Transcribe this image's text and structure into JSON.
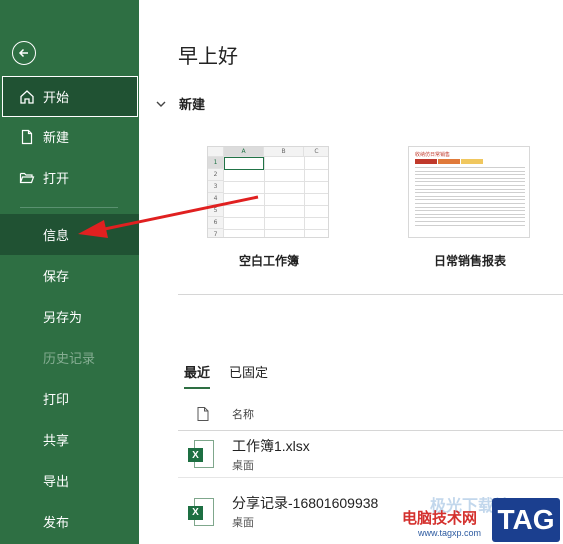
{
  "sidebar": {
    "back_icon": "back-arrow-icon",
    "items": [
      {
        "label": "开始",
        "icon": "home-icon"
      },
      {
        "label": "新建",
        "icon": "new-doc-icon"
      },
      {
        "label": "打开",
        "icon": "folder-open-icon"
      },
      {
        "label": "信息"
      },
      {
        "label": "保存"
      },
      {
        "label": "另存为"
      },
      {
        "label": "历史记录"
      },
      {
        "label": "打印"
      },
      {
        "label": "共享"
      },
      {
        "label": "导出"
      },
      {
        "label": "发布"
      }
    ]
  },
  "main": {
    "greeting": "早上好",
    "new_section": "新建",
    "templates": [
      {
        "name": "空白工作簿",
        "columns": [
          "A",
          "B",
          "C"
        ],
        "rows": [
          "1",
          "2",
          "3",
          "4",
          "5",
          "6",
          "7"
        ]
      },
      {
        "name": "日常销售报表",
        "preview_title": "收纳仿日常销售"
      }
    ],
    "tabs": [
      "最近",
      "已固定"
    ],
    "list_header": "名称",
    "files": [
      {
        "name": "工作簿1.xlsx",
        "location": "桌面"
      },
      {
        "name": "分享记录-16801609938",
        "location": "桌面"
      }
    ]
  },
  "watermark": {
    "site_name": "电脑技术网",
    "url": "www.tagxp.com",
    "tag": "TAG",
    "faint_text": "极光下载站"
  },
  "colors": {
    "sidebar_bg": "#2e6f43",
    "sidebar_selected": "#205233",
    "excel_green": "#1d6f42",
    "annotation_arrow": "#e02020"
  }
}
